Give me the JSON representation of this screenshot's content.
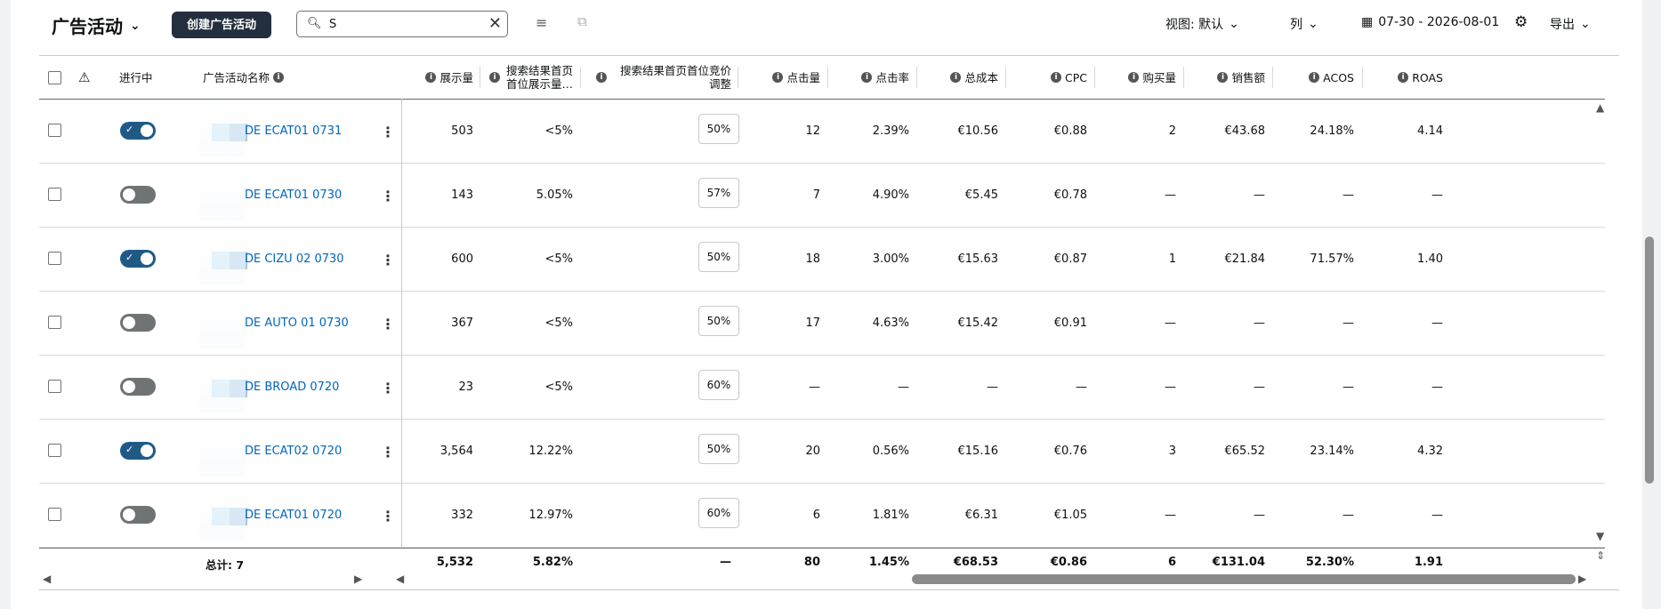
{
  "toolbar": {
    "title": "广告活动",
    "create_button": "创建广告活动",
    "search_value": "S",
    "search_clear": "✕",
    "view_label": "视图: 默认",
    "columns_label": "列",
    "date_range": "07-30 - 2026-08-01",
    "export_label": "导出"
  },
  "headers": {
    "active": "进行中",
    "name": "广告活动名称",
    "impressions": "展示量",
    "tos_share": "搜索结果首页首位展示量…",
    "tos_bid": "搜索结果首页首位竞价调整",
    "clicks": "点击量",
    "ctr": "点击率",
    "cost": "总成本",
    "cpc": "CPC",
    "purchases": "购买量",
    "sales": "销售额",
    "acos": "ACOS",
    "roas": "ROAS"
  },
  "rows": [
    {
      "active": true,
      "name": "DE ECAT01 0731",
      "impressions": "503",
      "tos_share": "<5%",
      "tos_bid": "50%",
      "clicks": "12",
      "ctr": "2.39%",
      "cost": "€10.56",
      "cpc": "€0.88",
      "purchases": "2",
      "sales": "€43.68",
      "acos": "24.18%",
      "roas": "4.14"
    },
    {
      "active": false,
      "name": "DE ECAT01 0730",
      "impressions": "143",
      "tos_share": "5.05%",
      "tos_bid": "57%",
      "clicks": "7",
      "ctr": "4.90%",
      "cost": "€5.45",
      "cpc": "€0.78",
      "purchases": "—",
      "sales": "—",
      "acos": "—",
      "roas": "—"
    },
    {
      "active": true,
      "name": "DE CIZU 02 0730",
      "impressions": "600",
      "tos_share": "<5%",
      "tos_bid": "50%",
      "clicks": "18",
      "ctr": "3.00%",
      "cost": "€15.63",
      "cpc": "€0.87",
      "purchases": "1",
      "sales": "€21.84",
      "acos": "71.57%",
      "roas": "1.40"
    },
    {
      "active": false,
      "name": "DE AUTO 01 0730",
      "impressions": "367",
      "tos_share": "<5%",
      "tos_bid": "50%",
      "clicks": "17",
      "ctr": "4.63%",
      "cost": "€15.42",
      "cpc": "€0.91",
      "purchases": "—",
      "sales": "—",
      "acos": "—",
      "roas": "—"
    },
    {
      "active": false,
      "name": "DE BROAD 0720",
      "impressions": "23",
      "tos_share": "<5%",
      "tos_bid": "60%",
      "clicks": "—",
      "ctr": "—",
      "cost": "—",
      "cpc": "—",
      "purchases": "—",
      "sales": "—",
      "acos": "—",
      "roas": "—"
    },
    {
      "active": true,
      "name": "DE ECAT02 0720",
      "impressions": "3,564",
      "tos_share": "12.22%",
      "tos_bid": "50%",
      "clicks": "20",
      "ctr": "0.56%",
      "cost": "€15.16",
      "cpc": "€0.76",
      "purchases": "3",
      "sales": "€65.52",
      "acos": "23.14%",
      "roas": "4.32"
    },
    {
      "active": false,
      "name": "DE ECAT01 0720",
      "impressions": "332",
      "tos_share": "12.97%",
      "tos_bid": "60%",
      "clicks": "6",
      "ctr": "1.81%",
      "cost": "€6.31",
      "cpc": "€1.05",
      "purchases": "—",
      "sales": "—",
      "acos": "—",
      "roas": "—"
    }
  ],
  "totals": {
    "label": "总计: 7",
    "impressions": "5,532",
    "tos_share": "5.82%",
    "tos_bid": "—",
    "clicks": "80",
    "ctr": "1.45%",
    "cost": "€68.53",
    "cpc": "€0.86",
    "purchases": "6",
    "sales": "€131.04",
    "acos": "52.30%",
    "roas": "1.91"
  }
}
